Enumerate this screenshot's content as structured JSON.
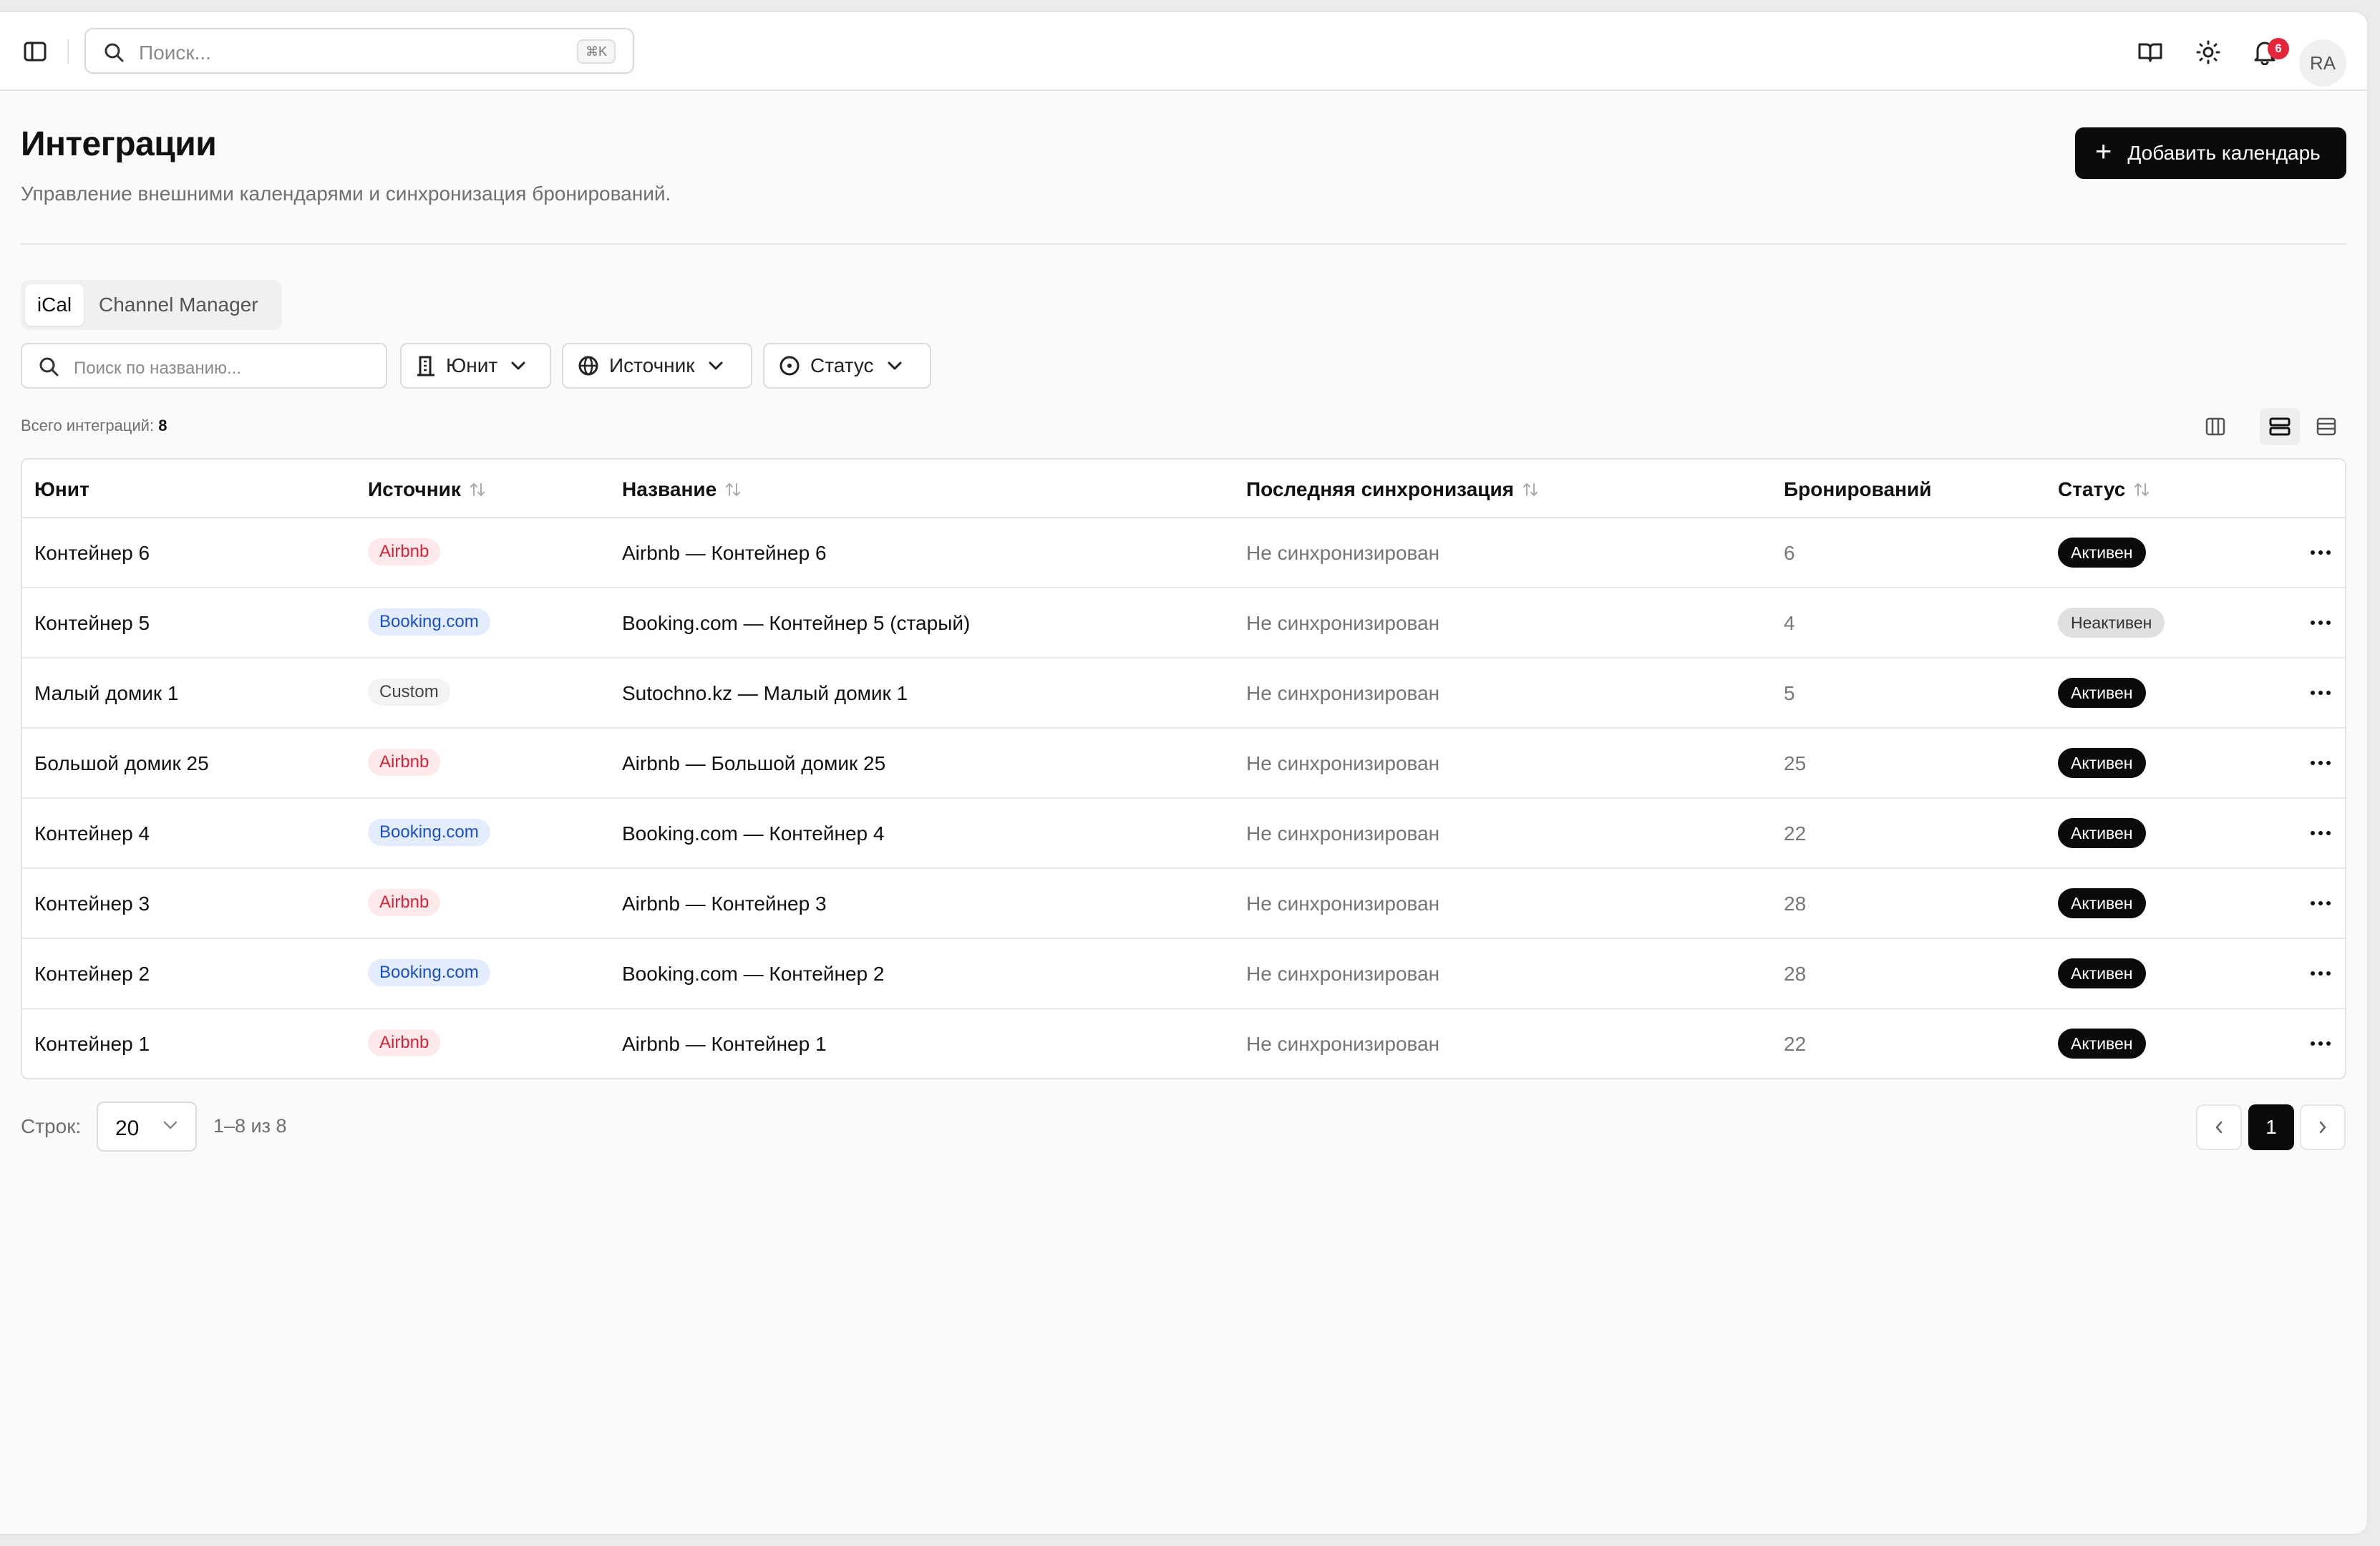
{
  "topbar": {
    "search_placeholder": "Поиск...",
    "search_shortcut": "⌘K",
    "notifications_count": "6",
    "avatar_initials": "RA"
  },
  "page": {
    "title": "Интеграции",
    "subtitle": "Управление внешними календарями и синхронизация бронирований.",
    "add_button_label": "Добавить календарь"
  },
  "tabs": [
    {
      "label": "iCal",
      "active": true
    },
    {
      "label": "Channel Manager",
      "active": false
    }
  ],
  "filters": {
    "search_placeholder": "Поиск по названию...",
    "unit_label": "Юнит",
    "source_label": "Источник",
    "status_label": "Статус"
  },
  "summary": {
    "total_label": "Всего интеграций:",
    "total_value": "8"
  },
  "table": {
    "columns": [
      "Юнит",
      "Источник",
      "Название",
      "Последняя синхронизация",
      "Бронирований",
      "Статус"
    ],
    "rows": [
      {
        "unit": "Контейнер 6",
        "source": "Airbnb",
        "name": "Airbnb — Контейнер 6",
        "last_sync": "Не синхронизирован",
        "bookings": "6",
        "status": "Активен"
      },
      {
        "unit": "Контейнер 5",
        "source": "Booking.com",
        "name": "Booking.com — Контейнер 5 (старый)",
        "last_sync": "Не синхронизирован",
        "bookings": "4",
        "status": "Неактивен"
      },
      {
        "unit": "Малый домик 1",
        "source": "Custom",
        "name": "Sutochno.kz — Малый домик 1",
        "last_sync": "Не синхронизирован",
        "bookings": "5",
        "status": "Активен"
      },
      {
        "unit": "Большой домик 25",
        "source": "Airbnb",
        "name": "Airbnb — Большой домик 25",
        "last_sync": "Не синхронизирован",
        "bookings": "25",
        "status": "Активен"
      },
      {
        "unit": "Контейнер 4",
        "source": "Booking.com",
        "name": "Booking.com — Контейнер 4",
        "last_sync": "Не синхронизирован",
        "bookings": "22",
        "status": "Активен"
      },
      {
        "unit": "Контейнер 3",
        "source": "Airbnb",
        "name": "Airbnb — Контейнер 3",
        "last_sync": "Не синхронизирован",
        "bookings": "28",
        "status": "Активен"
      },
      {
        "unit": "Контейнер 2",
        "source": "Booking.com",
        "name": "Booking.com — Контейнер 2",
        "last_sync": "Не синхронизирован",
        "bookings": "28",
        "status": "Активен"
      },
      {
        "unit": "Контейнер 1",
        "source": "Airbnb",
        "name": "Airbnb — Контейнер 1",
        "last_sync": "Не синхронизирован",
        "bookings": "22",
        "status": "Активен"
      }
    ]
  },
  "pagination": {
    "rows_label": "Строк:",
    "rows_per_page": "20",
    "range_text": "1–8 из 8",
    "current_page": "1"
  },
  "colors": {
    "airbnb_bg": "#fde8ea",
    "airbnb_text": "#d0263c",
    "booking_bg": "#e3edfd",
    "booking_text": "#1d4fc4",
    "custom_bg": "#f3f3f3",
    "custom_text": "#444444",
    "active_bg": "#0b0b0b",
    "active_text": "#ffffff",
    "inactive_bg": "#e0e0e0",
    "inactive_text": "#333333"
  }
}
